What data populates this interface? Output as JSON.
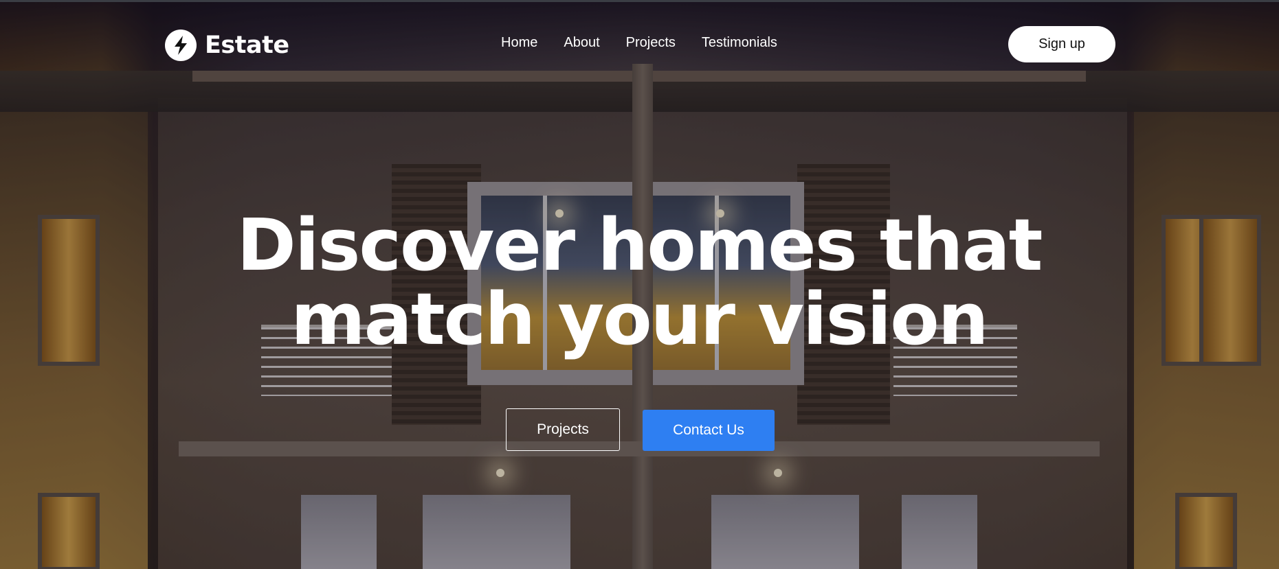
{
  "brand": {
    "name": "Estate",
    "icon": "lightning-bolt-icon"
  },
  "nav": {
    "items": [
      {
        "label": "Home"
      },
      {
        "label": "About"
      },
      {
        "label": "Projects"
      },
      {
        "label": "Testimonials"
      }
    ],
    "signup_label": "Sign up"
  },
  "hero": {
    "headline_line1": "Discover homes that",
    "headline_line2": "match your vision",
    "secondary_button": "Projects",
    "primary_button": "Contact Us",
    "background_image": "night-townhouse-facade"
  },
  "colors": {
    "primary": "#2e7ff2",
    "text": "#ffffff"
  }
}
